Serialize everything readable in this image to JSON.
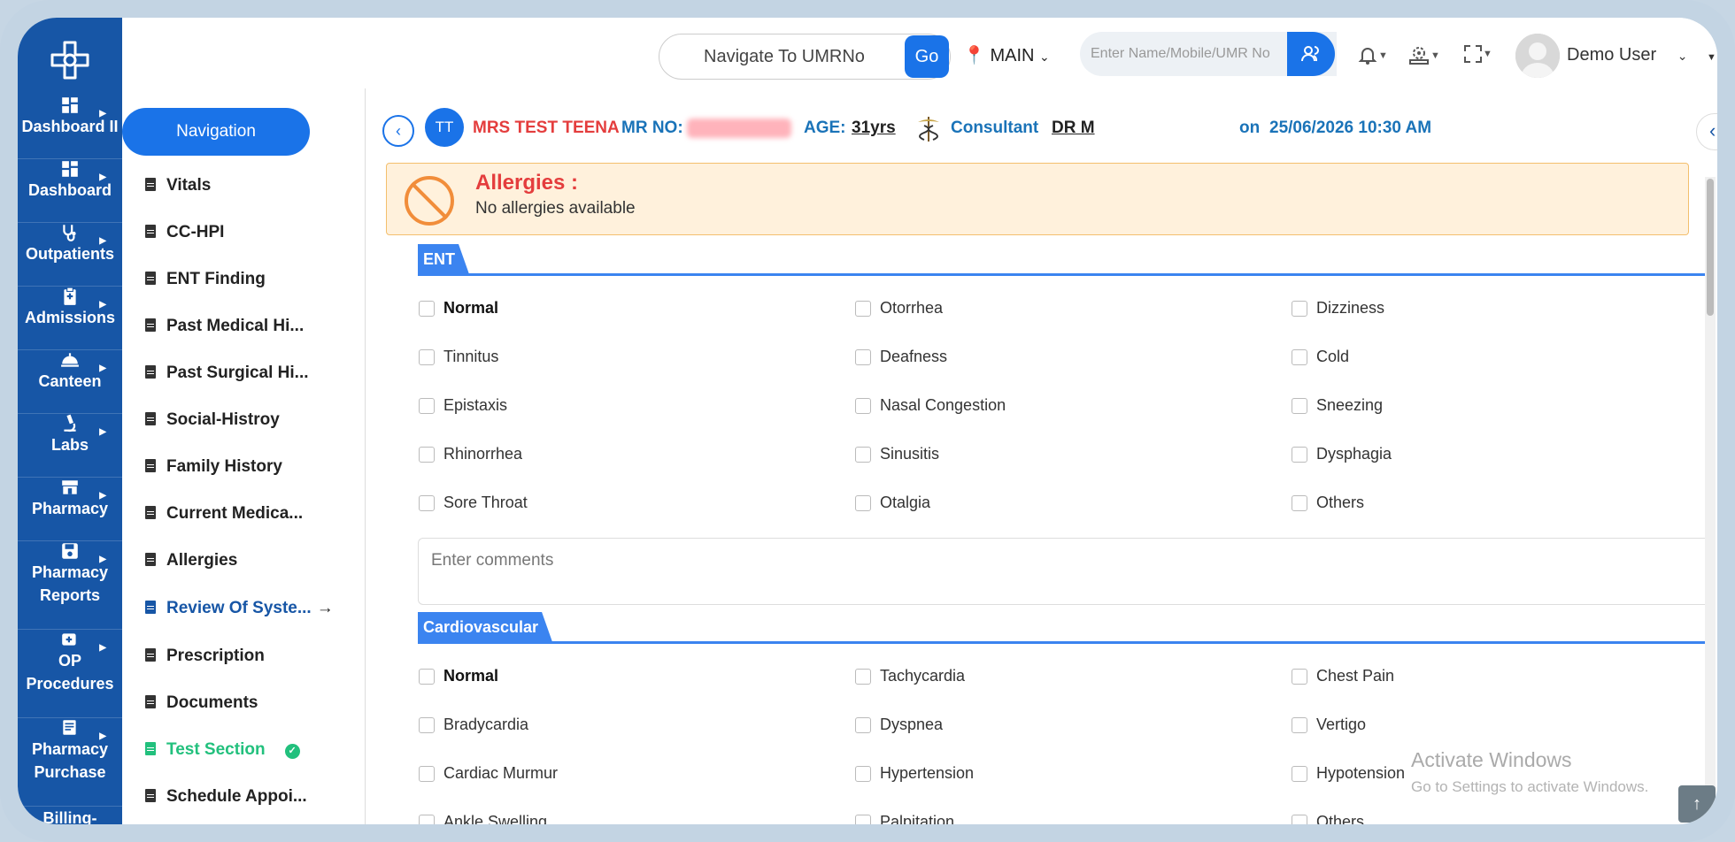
{
  "sidebar": {
    "items": [
      {
        "label": "Dashboard II",
        "icon": "dashboard-icon"
      },
      {
        "label": "Dashboard",
        "icon": "dashboard-icon"
      },
      {
        "label": "Outpatients",
        "icon": "stethoscope-icon"
      },
      {
        "label": "Admissions",
        "icon": "clipboard-icon"
      },
      {
        "label": "Canteen",
        "icon": "canteen-icon"
      },
      {
        "label": "Labs",
        "icon": "microscope-icon"
      },
      {
        "label": "Pharmacy",
        "icon": "store-icon"
      },
      {
        "label": "Pharmacy Reports",
        "icon": "save-icon"
      },
      {
        "label": "OP Procedures",
        "icon": "plus-icon"
      },
      {
        "label": "Pharmacy Purchase",
        "icon": "receipt-icon"
      },
      {
        "label": "Billing-",
        "icon": "billing-icon"
      }
    ]
  },
  "subnav": {
    "title": "Navigation",
    "items": [
      {
        "label": "Vitals",
        "state": "normal"
      },
      {
        "label": "CC-HPI",
        "state": "normal"
      },
      {
        "label": "ENT Finding",
        "state": "normal"
      },
      {
        "label": "Past Medical Hi...",
        "state": "normal"
      },
      {
        "label": "Past Surgical Hi...",
        "state": "normal"
      },
      {
        "label": "Social-Histroy",
        "state": "normal"
      },
      {
        "label": "Family History",
        "state": "normal"
      },
      {
        "label": "Current Medica...",
        "state": "normal"
      },
      {
        "label": "Allergies",
        "state": "normal"
      },
      {
        "label": "Review Of Syste...",
        "state": "active"
      },
      {
        "label": "Prescription",
        "state": "normal"
      },
      {
        "label": "Documents",
        "state": "normal"
      },
      {
        "label": "Test Section",
        "state": "done"
      },
      {
        "label": "Schedule Appoi...",
        "state": "normal"
      }
    ]
  },
  "topbar": {
    "umr_placeholder": "Navigate To UMRNo",
    "go_label": "Go",
    "location": "MAIN",
    "search_placeholder": "Enter Name/Mobile/UMR No",
    "user_name": "Demo User"
  },
  "patient": {
    "initials": "TT",
    "name": "MRS TEST TEENA",
    "mr_label": "MR NO:",
    "age_label": "AGE:",
    "age": "31yrs",
    "consultant_label": "Consultant",
    "consultant": "DR M",
    "on_label": "on",
    "datetime": "25/06/2026 10:30 AM"
  },
  "allergies": {
    "title": "Allergies :",
    "text": "No allergies available"
  },
  "ent": {
    "title": "ENT",
    "options": [
      "Normal",
      "Otorrhea",
      "Dizziness",
      "Tinnitus",
      "Deafness",
      "Cold",
      "Epistaxis",
      "Nasal Congestion",
      "Sneezing",
      "Rhinorrhea",
      "Sinusitis",
      "Dysphagia",
      "Sore Throat",
      "Otalgia",
      "Others"
    ],
    "comments_placeholder": "Enter comments"
  },
  "cardio": {
    "title": "Cardiovascular",
    "options": [
      "Normal",
      "Tachycardia",
      "Chest Pain",
      "Bradycardia",
      "Dyspnea",
      "Vertigo",
      "Cardiac Murmur",
      "Hypertension",
      "Hypotension",
      "Ankle Swelling",
      "Palpitation",
      "Others"
    ]
  },
  "watermark": {
    "line1": "Activate Windows",
    "line2": "Go to Settings to activate Windows."
  },
  "colors": {
    "sidebar": "#1756a6",
    "accent": "#1a73e8",
    "allergy_bg": "#fff1dc",
    "success": "#22c07d",
    "patient_name": "#e43d3d"
  }
}
